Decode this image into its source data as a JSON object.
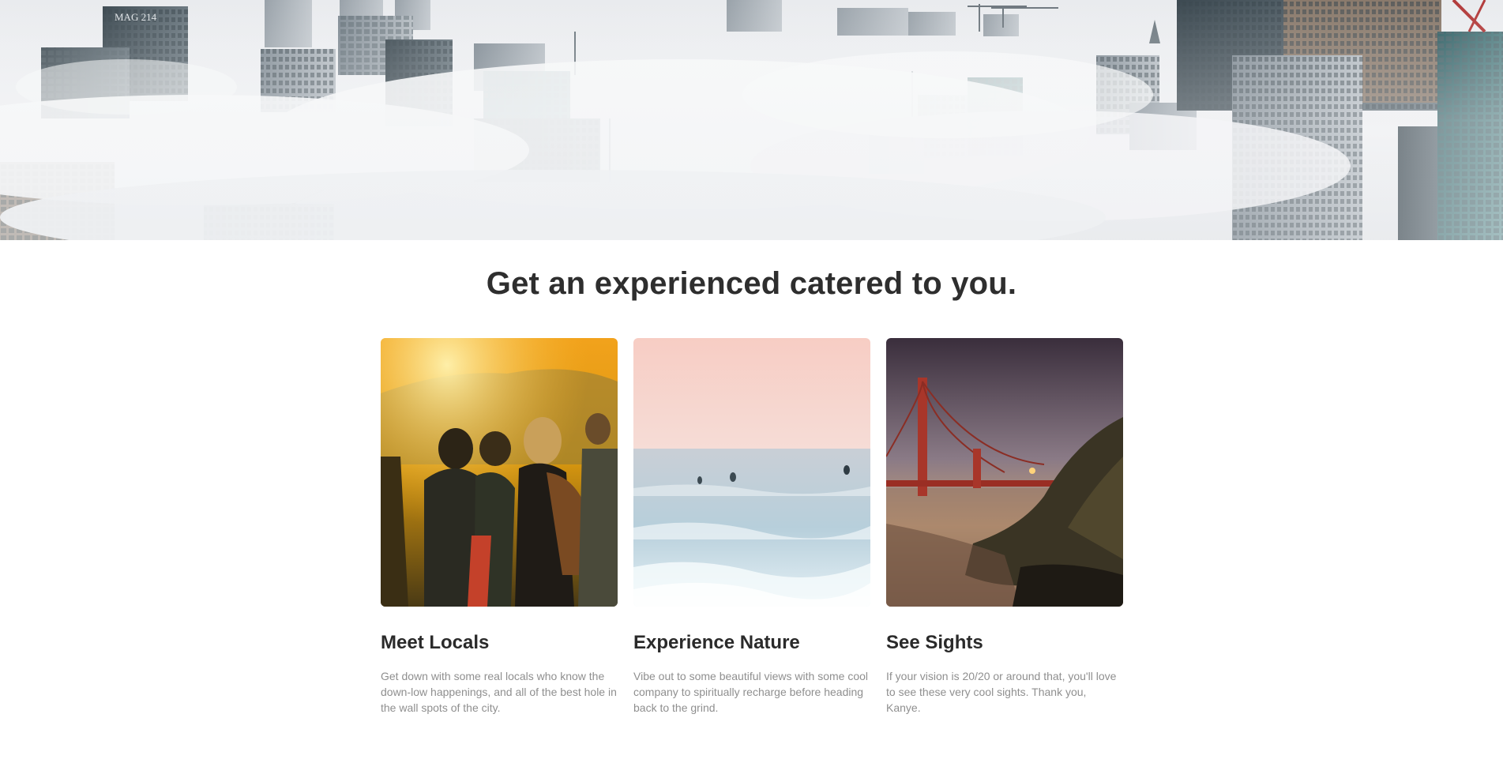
{
  "hero": {
    "building_sign": "MAG 214"
  },
  "section": {
    "title": "Get an experienced catered to you."
  },
  "cards": [
    {
      "title": "Meet Locals",
      "text": "Get down with some real locals who know the down-low happenings, and all of the best hole in the wall spots of the city."
    },
    {
      "title": "Experience Nature",
      "text": "Vibe out to some beautiful views with some cool company to spiritually recharge before heading back to the grind."
    },
    {
      "title": "See Sights",
      "text": "If your vision is 20/20 or around that, you'll love to see these very cool sights. Thank you, Kanye."
    }
  ]
}
